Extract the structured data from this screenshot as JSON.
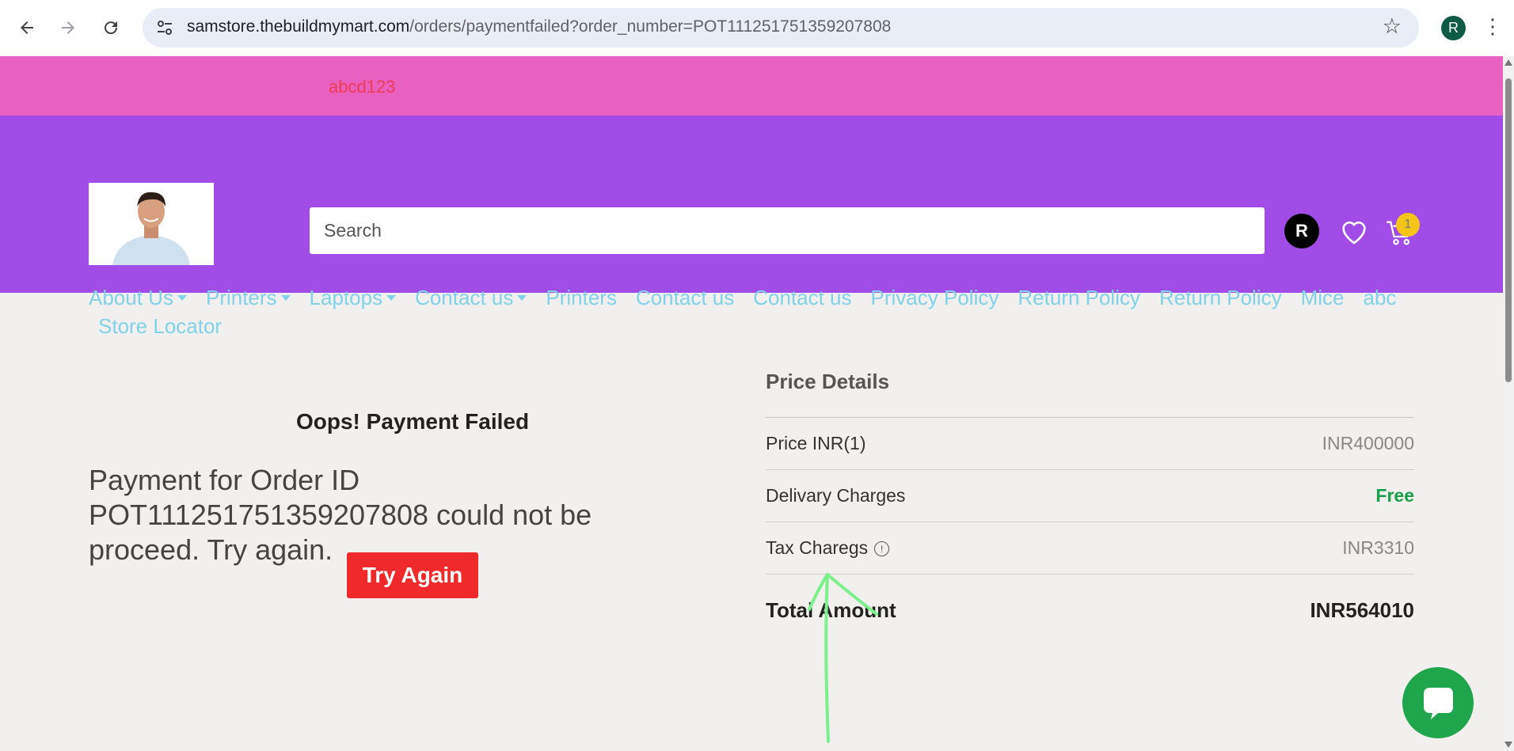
{
  "browser": {
    "url_host": "samstore.thebuildmymart.com",
    "url_path": "/orders/paymentfailed?order_number=POT111251751359207808",
    "profile_initial": "R",
    "icons": [
      "back-arrow-icon",
      "forward-arrow-icon",
      "reload-icon",
      "site-settings-icon",
      "star-icon",
      "kebab-menu-icon"
    ]
  },
  "topbar": {
    "text": "abcd123"
  },
  "header": {
    "search_placeholder": "Search",
    "avatar_initial": "R",
    "cart_count": "1",
    "menu_row1": [
      {
        "label": "About Us",
        "dropdown": true
      },
      {
        "label": "Printers",
        "dropdown": true
      },
      {
        "label": "Laptops",
        "dropdown": true
      },
      {
        "label": "Contact us",
        "dropdown": true
      },
      {
        "label": "Printers",
        "dropdown": false
      },
      {
        "label": "Contact us",
        "dropdown": false
      },
      {
        "label": "Contact us",
        "dropdown": false
      },
      {
        "label": "Privacy Policy",
        "dropdown": false
      },
      {
        "label": "Return Policy",
        "dropdown": false
      },
      {
        "label": "Return Policy",
        "dropdown": false
      },
      {
        "label": "Mice",
        "dropdown": false
      },
      {
        "label": "abc",
        "dropdown": false
      }
    ],
    "menu_row2": [
      {
        "label": "Store Locator",
        "dropdown": false
      }
    ]
  },
  "main": {
    "fail_title": "Oops! Payment Failed",
    "fail_message": "Payment for Order ID POT111251751359207808 could not be proceed. Try again.",
    "try_again_label": "Try Again"
  },
  "price_details": {
    "title": "Price Details",
    "rows": [
      {
        "label": "Price INR(1)",
        "value": "INR400000"
      },
      {
        "label": "Delivary Charges",
        "value": "Free"
      },
      {
        "label": "Tax Charegs",
        "value": "INR3310"
      }
    ],
    "total_label": "Total Amount",
    "total_value": "INR564010"
  },
  "colors": {
    "topbar": "#e860c0",
    "header": "#a24ce8",
    "menu_text": "#7fd2e8",
    "try_again": "#f02a2a",
    "free": "#18a14a",
    "chat": "#1fa64c",
    "annotation_arrow": "#7cf08a"
  }
}
